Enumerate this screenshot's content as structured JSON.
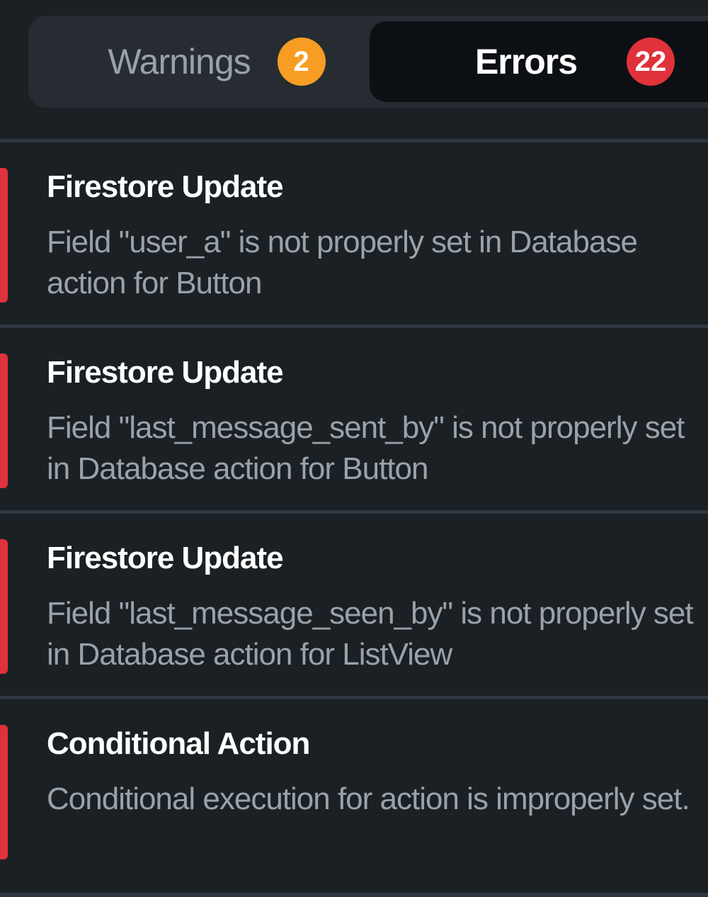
{
  "tabs": {
    "warnings": {
      "label": "Warnings",
      "count": "2"
    },
    "errors": {
      "label": "Errors",
      "count": "22"
    }
  },
  "colors": {
    "background": "#1b2024",
    "warning_badge": "#f79d24",
    "error_badge": "#e0323a",
    "error_bar": "#e0323a"
  },
  "issues": [
    {
      "title": "Firestore Update",
      "description": "Field \"user_a\" is not properly set in Database action for Button"
    },
    {
      "title": "Firestore Update",
      "description": "Field \"last_message_sent_by\" is not properly set in Database action for Button"
    },
    {
      "title": "Firestore Update",
      "description": "Field \"last_message_seen_by\" is not properly set in Database action for ListView"
    },
    {
      "title": "Conditional Action",
      "description": "Conditional execution for action is improperly set."
    }
  ]
}
